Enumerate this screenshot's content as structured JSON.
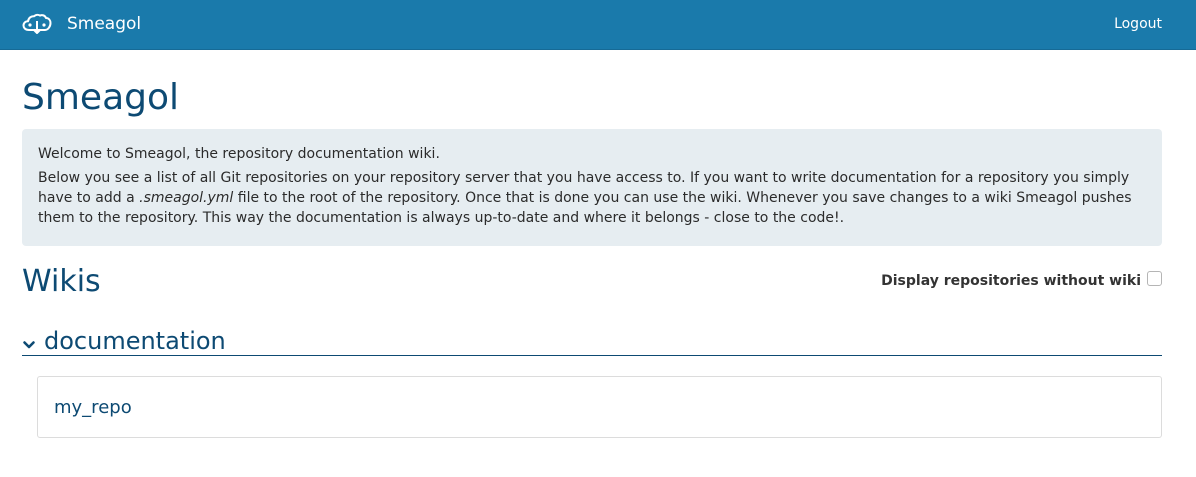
{
  "navbar": {
    "brand_icon": "cloud-icon",
    "brand_text": "Smeagol",
    "logout_label": "Logout",
    "background_color": "#1a7aab"
  },
  "page": {
    "title": "Smeagol"
  },
  "intro": {
    "welcome": "Welcome to Smeagol, the repository documentation wiki.",
    "paragraph_part1": "Below you see a list of all Git repositories on your repository server that you have access to. If you want to write documentation for a repository you simply have to add a ",
    "paragraph_file": ".smeagol.yml",
    "paragraph_part2": " file to the root of the repository. Once that is done you can use the wiki. Whenever you save changes to a wiki Smeagol pushes them to the repository. This way the documentation is always up-to-date and where it belongs - close to the code!."
  },
  "wikis": {
    "title": "Wikis",
    "toggle_label": "Display repositories without wiki",
    "toggle_checked": false,
    "groups": [
      {
        "name": "documentation",
        "expanded": true,
        "chevron_icon": "chevron-down-icon",
        "repositories": [
          {
            "name": "my_repo"
          }
        ]
      }
    ]
  },
  "colors": {
    "heading": "#0d4a73",
    "intro_background": "#e6edf1"
  }
}
